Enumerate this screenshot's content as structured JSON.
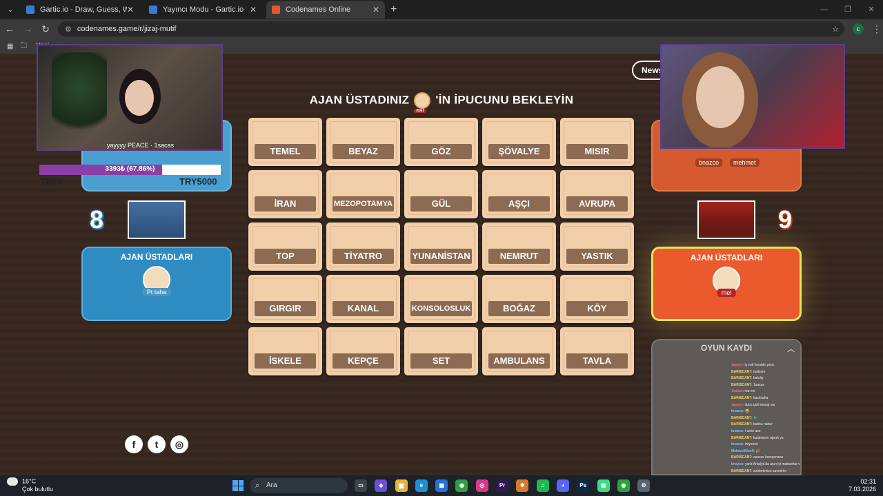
{
  "browser": {
    "tabs": [
      {
        "label": "Gartic.io - Draw, Guess, WIN",
        "color": "#3a7bd5",
        "active": false
      },
      {
        "label": "Yayıncı Modu - Gartic.io",
        "color": "#3a7bd5",
        "active": false
      },
      {
        "label": "Codenames Online",
        "color": "#e05a2a",
        "active": true
      }
    ],
    "new_tab": "+",
    "url": "codenames.game/r/jizaj-mutif",
    "bookmark": "Yeni",
    "profile_initial": "c"
  },
  "game": {
    "title_prefix": "AJAN ÜSTADINIZ",
    "title_avatar_name": "mel",
    "title_suffix": "'İN İPUCUNU BEKLEYİN",
    "news_label": "News",
    "board": [
      [
        "TEMEL",
        "BEYAZ",
        "GÖZ",
        "ŞÖVALYE",
        "MISIR"
      ],
      [
        "İRAN",
        "MEZOPOTAMYA",
        "GÜL",
        "AŞÇI",
        "AVRUPA"
      ],
      [
        "TOP",
        "TİYATRO",
        "YUNANİSTAN",
        "NEMRUT",
        "YASTIK"
      ],
      [
        "GIRGIR",
        "KANAL",
        "KONSOLOSLUK",
        "BOĞAZ",
        "KÖY"
      ],
      [
        "İSKELE",
        "KEPÇE",
        "SET",
        "AMBULANS",
        "TAVLA"
      ]
    ],
    "blue": {
      "score": "8",
      "operatives": [
        "yayyyy",
        "1sacas"
      ],
      "spymaster_title": "AJAN ÜSTADLARI",
      "spymaster": "Pt taha",
      "color": "#2f8cc2"
    },
    "red": {
      "score": "9",
      "operatives": [
        "bnazco",
        "mehmet"
      ],
      "spymaster_title": "AJAN ÜSTADLARI",
      "spymaster": "mel",
      "color": "#ea5a2c"
    },
    "overlay": {
      "progress_text": "3393₺ (67.86%)",
      "progress_value": 0.6786,
      "try_left": "TRY0",
      "try_right": "TRY5000",
      "peace_tag": "PEACE"
    },
    "log": {
      "title": "OYUN KAYDI",
      "lines": [
        {
          "who": "yayyyy",
          "text": ": iş yok herakle yaısı",
          "c": "r"
        },
        {
          "who": "BARISCAN7",
          "text": ": malcem",
          "c": "y"
        },
        {
          "who": "BARISCAN7",
          "text": ": farkıliş",
          "c": "y"
        },
        {
          "who": "BARISCAN7",
          "text": ": 1sacas",
          "c": "y"
        },
        {
          "who": "1sacas",
          "text": ": iran nx",
          "c": "r"
        },
        {
          "who": "BARISCAN7",
          "text": ": kaslıdaha",
          "c": "y"
        },
        {
          "who": "yayyyy",
          "text": ": aboo gizli mesaj var",
          "c": "r"
        },
        {
          "who": "bnazco",
          "text": ": 😂",
          "c": "b"
        },
        {
          "who": "BARISCAN7",
          "text": ": 🐦",
          "c": "y"
        },
        {
          "who": "BARISCAN7",
          "text": ": barika naber",
          "c": "y"
        },
        {
          "who": "bnazco",
          "text": ": i asko aso",
          "c": "b"
        },
        {
          "who": "BARISCAN7",
          "text": ": kulaklarım ağrıdı ya",
          "c": "y"
        },
        {
          "who": "bnazco",
          "text": ": miyeeee",
          "c": "b"
        },
        {
          "who": "Mehmet/Noelf",
          "text": ": 🎉",
          "c": "b"
        },
        {
          "who": "BARISCAN7",
          "text": ": asacas kareşenzea",
          "c": "y"
        },
        {
          "who": "bnazco",
          "text": ": yarlz Antalya'da aşırı iyi makarnlar var",
          "c": "b"
        },
        {
          "who": "BARISCAN7",
          "text": ": sohbetimize savınirim",
          "c": "y"
        }
      ]
    },
    "social": [
      "f",
      "t",
      "◎"
    ]
  },
  "taskbar": {
    "weather_temp": "16°C",
    "weather_desc": "Çok bulutlu",
    "search": "Ara",
    "time": "02:31",
    "date": "7.03.2026",
    "apps": [
      {
        "name": "task-view-icon",
        "color": "#3b444e",
        "glyph": "▭"
      },
      {
        "name": "copilot-icon",
        "color": "#6a4fd6",
        "glyph": "◆"
      },
      {
        "name": "file-explorer-icon",
        "color": "#e7b33a",
        "glyph": "▆"
      },
      {
        "name": "edge-icon",
        "color": "#1f8fd1",
        "glyph": "e"
      },
      {
        "name": "store-icon",
        "color": "#2a6fd6",
        "glyph": "▦"
      },
      {
        "name": "chrome-icon",
        "color": "#2ea043",
        "glyph": "◉"
      },
      {
        "name": "instagram-icon",
        "color": "#d6398a",
        "glyph": "◎"
      },
      {
        "name": "premiere-icon",
        "color": "#2b1a56",
        "glyph": "Pr"
      },
      {
        "name": "pinwheel-icon",
        "color": "#d67a2a",
        "glyph": "✱"
      },
      {
        "name": "spotify-icon",
        "color": "#1db954",
        "glyph": "♫"
      },
      {
        "name": "discord-icon",
        "color": "#5865f2",
        "glyph": "◕"
      },
      {
        "name": "photoshop-icon",
        "color": "#0b2a4a",
        "glyph": "Ps"
      },
      {
        "name": "android-icon",
        "color": "#3ddc84",
        "glyph": "▣"
      },
      {
        "name": "chrome-profile-icon",
        "color": "#2ea043",
        "glyph": "◉"
      },
      {
        "name": "settings-icon",
        "color": "#5a6470",
        "glyph": "⚙"
      }
    ]
  }
}
